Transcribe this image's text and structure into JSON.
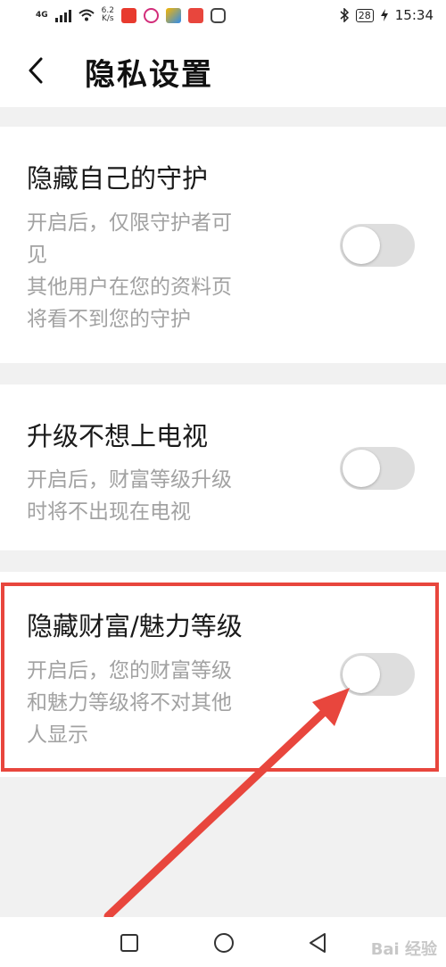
{
  "status_bar": {
    "network_type": "4G",
    "net_speed_value": "6.2",
    "net_speed_unit": "K/s",
    "battery": "28",
    "time": "15:34",
    "app_icons": [
      "news-app-icon",
      "video-app-icon",
      "game-app-icon",
      "book-app-icon",
      "shield-app-icon"
    ]
  },
  "header": {
    "title": "隐私设置"
  },
  "settings": [
    {
      "title": "隐藏自己的守护",
      "description": [
        "开启后，仅限守护者可",
        "见",
        "其他用户在您的资料页",
        "将看不到您的守护"
      ],
      "enabled": false
    },
    {
      "title": "升级不想上电视",
      "description": [
        "开启后，财富等级升级",
        "时将不出现在电视"
      ],
      "enabled": false
    },
    {
      "title": "隐藏财富/魅力等级",
      "description": [
        "开启后，您的财富等级",
        "和魅力等级将不对其他",
        "人显示"
      ],
      "enabled": false
    }
  ],
  "annotation": {
    "color": "#e8463d"
  },
  "watermark": "Bai 经验"
}
